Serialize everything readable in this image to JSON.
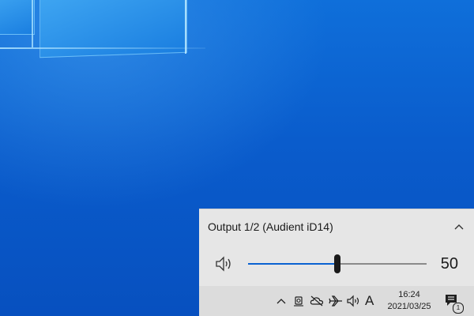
{
  "volume_flyout": {
    "device_label": "Output 1/2 (Audient iD14)",
    "volume_value": "50",
    "volume_level": 0.5
  },
  "taskbar": {
    "ime_label": "A",
    "clock_time": "16:24",
    "clock_date": "2021/03/25",
    "notification_count": "1",
    "tray_icons": [
      "chevron-up-icon",
      "meet-now-icon",
      "onedrive-icon",
      "airplane-icon",
      "speaker-icon"
    ]
  }
}
